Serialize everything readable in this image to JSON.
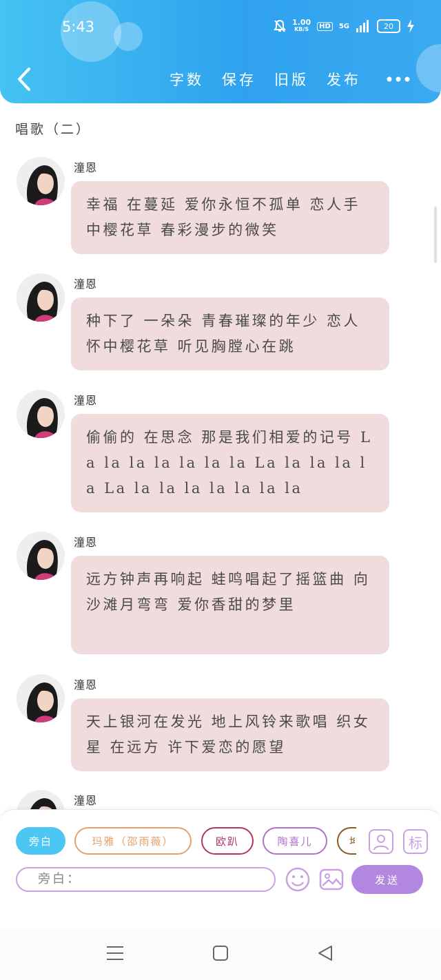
{
  "status_bar": {
    "time": "5:43",
    "speed_value": "1.00",
    "speed_unit": "KB/S",
    "hd": "HD",
    "network": "5G",
    "battery": "20"
  },
  "toolbar": {
    "word_count": "字数",
    "save": "保存",
    "old_version": "旧版",
    "publish": "发布"
  },
  "document": {
    "title": "唱歌（二）"
  },
  "messages": [
    {
      "speaker": "潼恩",
      "text": "幸福 在蔓延  爱你永恒不孤单  恋人手中樱花草  春彩漫步的微笑"
    },
    {
      "speaker": "潼恩",
      "text": "种下了  一朵朵  青春璀璨的年少  恋人怀中樱花草  听见胸膛心在跳"
    },
    {
      "speaker": "潼恩",
      "text": "偷偷的  在思念  那是我们相爱的记号  La la la la la la la  La la la la la  La la la la la la la la"
    },
    {
      "speaker": "潼恩",
      "text": "远方钟声再响起  蛙鸣唱起了摇篮曲  向沙滩月弯弯  爱你香甜的梦里"
    },
    {
      "speaker": "潼恩",
      "text": "天上银河在发光  地上风铃来歌唱  织女星 在远方  许下爱恋的愿望"
    },
    {
      "speaker": "潼恩",
      "text": ""
    }
  ],
  "role_chips": [
    {
      "label": "旁白",
      "color": "#4cc6f3"
    },
    {
      "label": "玛雅（邵雨薇）",
      "color": "#e8a06a"
    },
    {
      "label": "欧趴",
      "color": "#b0336a"
    },
    {
      "label": "陶喜儿",
      "color": "#b070c8"
    },
    {
      "label": "坤",
      "color": "#8a5a2a"
    }
  ],
  "composer": {
    "placeholder": "旁白：",
    "send_label": "发送",
    "tag_label": "标"
  },
  "colors": {
    "accent": "#2fa2ee",
    "bubble": "#f0dcdd",
    "purple": "#b287e0"
  }
}
